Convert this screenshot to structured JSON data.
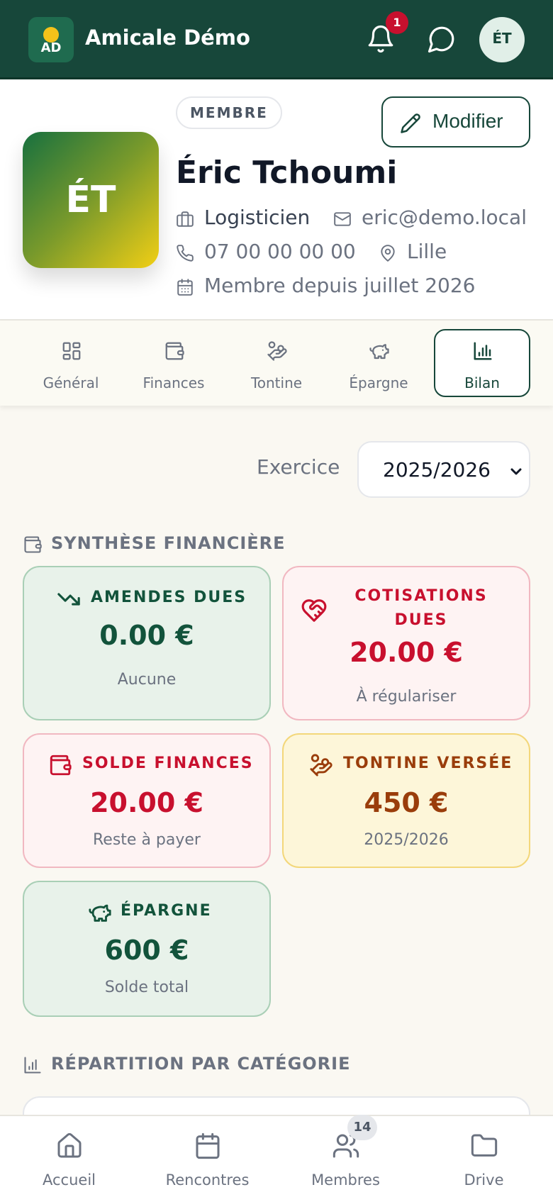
{
  "header": {
    "logo_text": "AD",
    "app_name": "Amicale Démo",
    "notification_count": "1",
    "user_initials": "ÉT",
    "icons": [
      "bell-icon",
      "chat-icon"
    ]
  },
  "profile": {
    "role_badge": "MEMBRE",
    "edit_label": "Modifier",
    "initials": "ÉT",
    "name": "Éric Tchoumi",
    "job": "Logisticien",
    "email": "eric@demo.local",
    "phone": "07 00 00 00 00",
    "city": "Lille",
    "member_since": "Membre depuis juillet 2026"
  },
  "tabs": [
    {
      "label": "Général",
      "icon": "grid-icon"
    },
    {
      "label": "Finances",
      "icon": "wallet-icon"
    },
    {
      "label": "Tontine",
      "icon": "hand-coins-icon"
    },
    {
      "label": "Épargne",
      "icon": "piggy-bank-icon"
    },
    {
      "label": "Bilan",
      "icon": "bar-chart-icon",
      "active": true
    }
  ],
  "exercise": {
    "label": "Exercice",
    "selected": "2025/2026"
  },
  "summary": {
    "title": "SYNTHÈSE FINANCIÈRE",
    "cards": [
      {
        "title": "AMENDES DUES",
        "value": "0.00 €",
        "sub": "Aucune",
        "tone": "green"
      },
      {
        "title_line1": "COTISATIONS",
        "title_line2": "DUES",
        "value": "20.00 €",
        "sub": "À régulariser",
        "tone": "red"
      },
      {
        "title": "SOLDE FINANCES",
        "value": "20.00 €",
        "sub": "Reste à payer",
        "tone": "red"
      },
      {
        "title": "TONTINE VERSÉE",
        "value": "450 €",
        "sub": "2025/2026",
        "tone": "yellow"
      },
      {
        "title": "ÉPARGNE",
        "value": "600 €",
        "sub": "Solde total",
        "tone": "green"
      }
    ]
  },
  "breakdown": {
    "title": "RÉPARTITION PAR CATÉGORIE"
  },
  "bottom_nav": {
    "items": [
      {
        "label": "Accueil",
        "icon": "home-icon"
      },
      {
        "label": "Rencontres",
        "icon": "calendar-icon"
      },
      {
        "label": "Membres",
        "icon": "users-icon"
      },
      {
        "label": "Drive",
        "icon": "folder-icon"
      }
    ],
    "members_count": "14"
  },
  "colors": {
    "primary": "#17473a",
    "accent_yellow": "#f4c21a",
    "danger": "#c8102e",
    "amber": "#9a3d0b"
  }
}
